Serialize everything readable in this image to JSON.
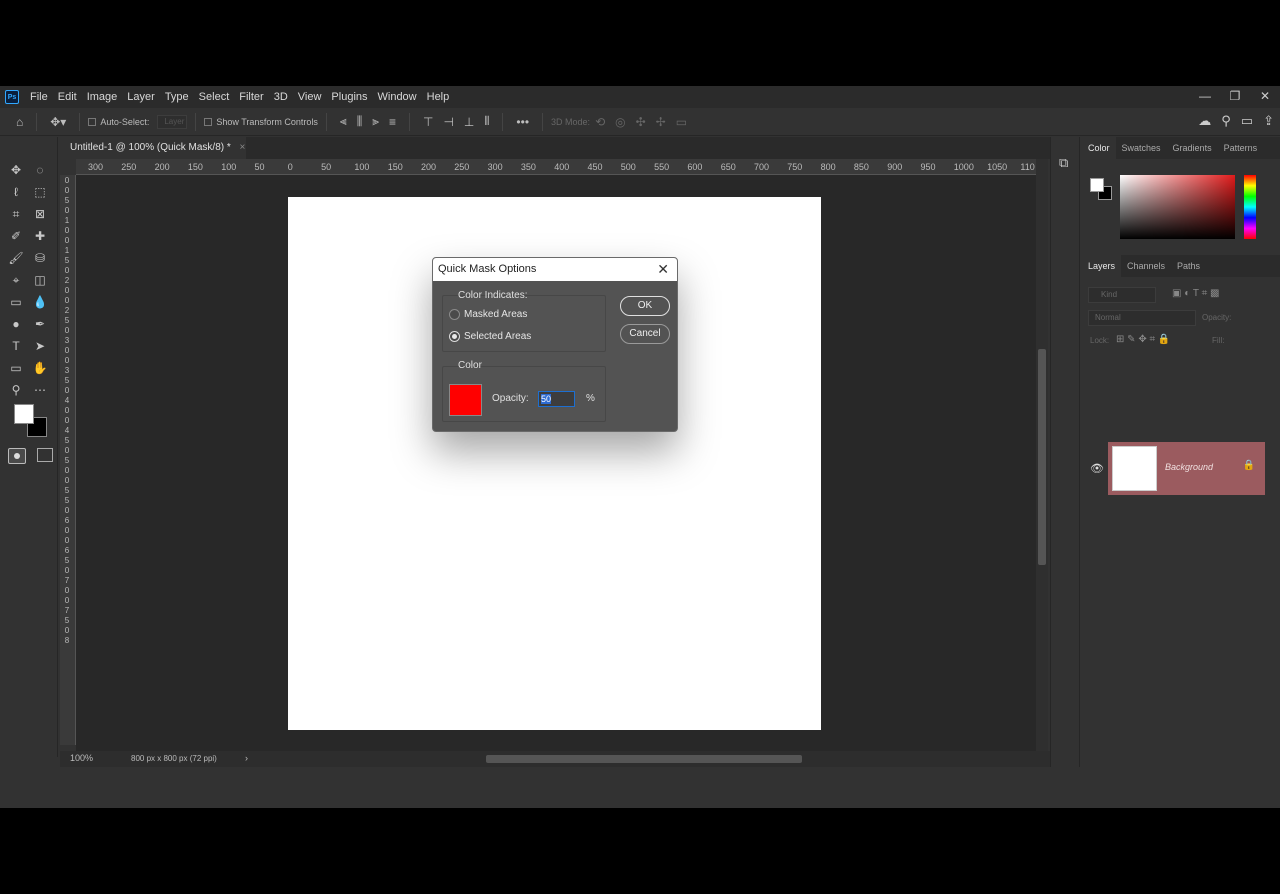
{
  "app": {
    "logo": "Ps"
  },
  "menu": [
    "File",
    "Edit",
    "Image",
    "Layer",
    "Type",
    "Select",
    "Filter",
    "3D",
    "View",
    "Plugins",
    "Window",
    "Help"
  ],
  "window_controls": {
    "minimize": "—",
    "restore": "❐",
    "close": "✕"
  },
  "options_bar": {
    "auto_select_label": "Auto-Select:",
    "auto_select_value": "Layer",
    "show_transform_label": "Show Transform Controls",
    "more": "•••",
    "mode_3d_label": "3D Mode:"
  },
  "document": {
    "tab_title": "Untitled-1 @ 100% (Quick Mask/8) *",
    "tab_close": "×",
    "zoom": "100%",
    "doc_size": "800 px x 800 px (72 ppi)",
    "status_arrow": "›"
  },
  "ruler_h": [
    "300",
    "250",
    "200",
    "150",
    "100",
    "50",
    "0",
    "50",
    "100",
    "150",
    "200",
    "250",
    "300",
    "350",
    "400",
    "450",
    "500",
    "550",
    "600",
    "650",
    "700",
    "750",
    "800",
    "850",
    "900",
    "950",
    "1000",
    "1050",
    "110"
  ],
  "ruler_v": [
    "0",
    "0",
    "5",
    "0",
    "1",
    "0",
    "0",
    "1",
    "5",
    "0",
    "2",
    "0",
    "0",
    "2",
    "5",
    "0",
    "3",
    "0",
    "0",
    "3",
    "5",
    "0",
    "4",
    "0",
    "0",
    "4",
    "5",
    "0",
    "5",
    "0",
    "0",
    "5",
    "5",
    "0",
    "6",
    "0",
    "0",
    "6",
    "5",
    "0",
    "7",
    "0",
    "0",
    "7",
    "5",
    "0",
    "8"
  ],
  "color_panel": {
    "tabs": [
      "Color",
      "Swatches",
      "Gradients",
      "Patterns"
    ]
  },
  "layers_panel": {
    "tabs": [
      "Layers",
      "Channels",
      "Paths"
    ],
    "kind_placeholder": "Kind",
    "blend_mode": "Normal",
    "opacity_label": "Opacity:",
    "lock_label": "Lock:",
    "fill_label": "Fill:",
    "layer_name": "Background"
  },
  "dialog": {
    "title": "Quick Mask Options",
    "color_indicates_label": "Color Indicates:",
    "masked_areas_label": "Masked Areas",
    "selected_areas_label": "Selected Areas",
    "selected_option": "selected_areas",
    "color_group_label": "Color",
    "opacity_label": "Opacity:",
    "opacity_value": "50",
    "opacity_unit": "%",
    "ok_label": "OK",
    "cancel_label": "Cancel",
    "close_symbol": "✕",
    "mask_color": "#ff0000"
  },
  "colors": {
    "foreground": "#ffffff",
    "background": "#000000",
    "layer_highlight": "#9b5b5f",
    "accent": "#1d6fd1"
  },
  "icons": {
    "tools": [
      "move-icon",
      "marquee-icon",
      "lasso-icon",
      "object-select-icon",
      "crop-icon",
      "frame-icon",
      "eyedropper-icon",
      "healing-icon",
      "brush-icon",
      "stamp-icon",
      "history-brush-icon",
      "eraser-icon",
      "gradient-icon",
      "blur-icon",
      "dodge-icon",
      "pen-icon",
      "type-icon",
      "path-select-icon",
      "rectangle-icon",
      "hand-icon",
      "zoom-icon",
      "more-tools-icon"
    ],
    "tool_glyphs": [
      "✥",
      "◌",
      "ℓ",
      "⬚",
      "⌗",
      "⊠",
      "✐",
      "✚",
      "🖌",
      "⛁",
      "⌖",
      "◫",
      "▭",
      "💧",
      "●",
      "✒",
      "T",
      "➤",
      "▭",
      "✋",
      "⚲",
      "⋯"
    ]
  }
}
